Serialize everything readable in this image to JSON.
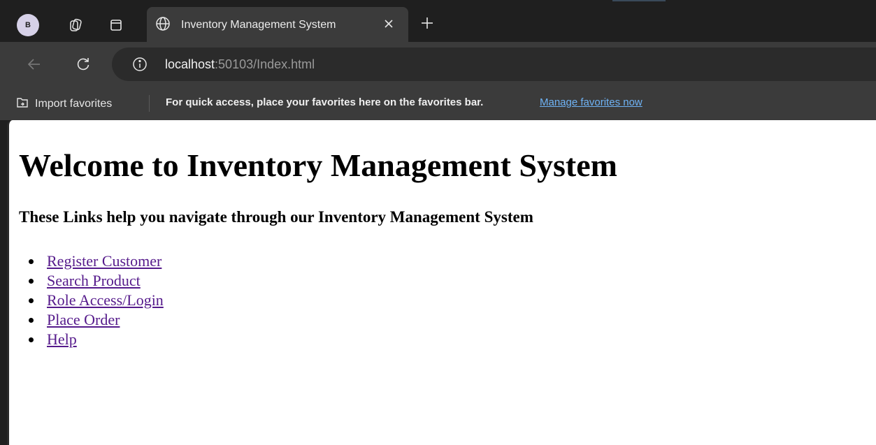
{
  "browser": {
    "profile_initial": "B",
    "tab": {
      "title": "Inventory Management System"
    },
    "address": {
      "host": "localhost",
      "rest": ":50103/Index.html"
    },
    "favorites": {
      "import_label": "Import favorites",
      "message": "For quick access, place your favorites here on the favorites bar.",
      "manage_link": "Manage favorites now"
    },
    "icons": [
      "profile-avatar",
      "workspaces-icon",
      "tab-actions-icon",
      "globe-icon",
      "close-icon",
      "new-tab-icon",
      "back-icon",
      "refresh-icon",
      "info-icon",
      "import-favorites-icon"
    ]
  },
  "page": {
    "heading": "Welcome to Inventory Management System",
    "subheading": "These Links help you navigate through our Inventory Management System",
    "links": [
      {
        "label": "Register Customer"
      },
      {
        "label": "Search Product"
      },
      {
        "label": "Role Access/Login"
      },
      {
        "label": "Place Order"
      },
      {
        "label": "Help"
      }
    ]
  },
  "colors": {
    "browser_chrome": "#3b3b3b",
    "tabstrip": "#1f1f1f",
    "visited_link": "#551a8b",
    "favorites_link": "#6fb3f5"
  }
}
